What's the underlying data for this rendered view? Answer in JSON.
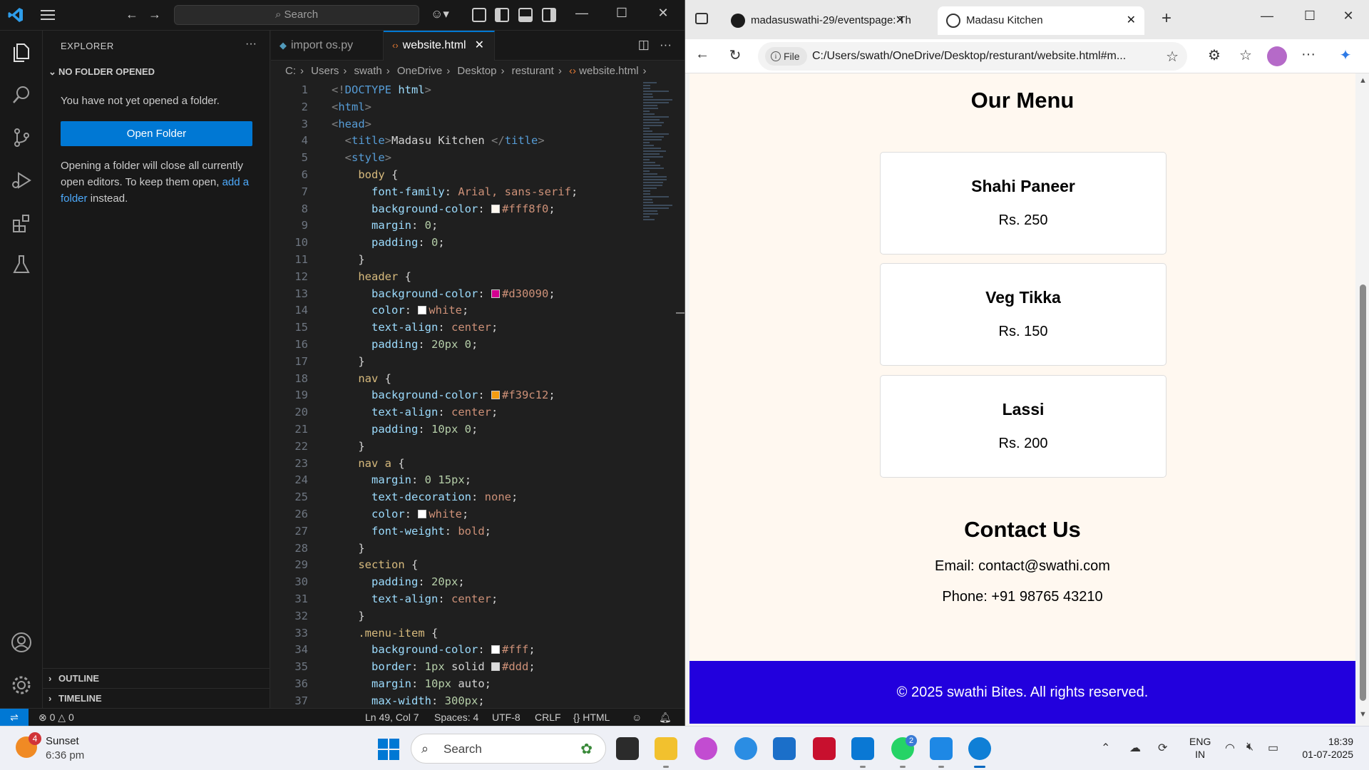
{
  "vscode": {
    "title_search": "Search",
    "sidebar": {
      "title": "EXPLORER",
      "section_open": "NO FOLDER OPENED",
      "message": "You have not yet opened a folder.",
      "open_folder_button": "Open Folder",
      "help_text_1": "Opening a folder will close all currently open editors. To keep them open,",
      "help_link": "add a folder",
      "help_text_2": "instead.",
      "outline": "OUTLINE",
      "timeline": "TIMELINE"
    },
    "tabs": [
      {
        "label": "import os.py",
        "active": false
      },
      {
        "label": "website.html",
        "active": true
      }
    ],
    "breadcrumb": [
      "C:",
      "Users",
      "swath",
      "OneDrive",
      "Desktop",
      "resturant",
      "website.html"
    ],
    "code_lines": [
      "<!DOCTYPE html>",
      "<html>",
      "<head>",
      "  <title>Madasu Kitchen </title>",
      "  <style>",
      "    body {",
      "      font-family: Arial, sans-serif;",
      "      background-color: #fff8f0;",
      "      margin: 0;",
      "      padding: 0;",
      "    }",
      "    header {",
      "      background-color: #d30090;",
      "      color: white;",
      "      text-align: center;",
      "      padding: 20px 0;",
      "    }",
      "    nav {",
      "      background-color: #f39c12;",
      "      text-align: center;",
      "      padding: 10px 0;",
      "    }",
      "    nav a {",
      "      margin: 0 15px;",
      "      text-decoration: none;",
      "      color: white;",
      "      font-weight: bold;",
      "    }",
      "    section {",
      "      padding: 20px;",
      "      text-align: center;",
      "    }",
      "    .menu-item {",
      "      background-color: #fff;",
      "      border: 1px solid #ddd;",
      "      margin: 10px auto;",
      "      max-width: 300px;"
    ],
    "status": {
      "errors": "0",
      "warnings": "0",
      "position": "Ln 49, Col 7",
      "spaces": "Spaces: 4",
      "encoding": "UTF-8",
      "eol": "CRLF",
      "language": "HTML"
    }
  },
  "edge": {
    "tabs": [
      {
        "label": "madasuswathi-29/eventspage: Th",
        "icon": "github-icon",
        "active": false
      },
      {
        "label": "Madasu Kitchen",
        "icon": "globe-icon",
        "active": true
      }
    ],
    "address": {
      "scheme_chip": "File",
      "url": "C:/Users/swath/OneDrive/Desktop/resturant/website.html#m..."
    },
    "page": {
      "menu_heading": "Our Menu",
      "menu_items": [
        {
          "name": "Shahi Paneer",
          "price": "Rs. 250"
        },
        {
          "name": "Veg Tikka",
          "price": "Rs. 150"
        },
        {
          "name": "Lassi",
          "price": "Rs. 200"
        }
      ],
      "contact_heading": "Contact Us",
      "email": "Email: contact@swathi.com",
      "phone": "Phone: +91 98765 43210",
      "footer": "© 2025 swathi Bites. All rights reserved."
    }
  },
  "taskbar": {
    "weather_title": "Sunset",
    "weather_time": "6:36 pm",
    "weather_badge": "4",
    "search_label": "Search",
    "whatsapp_badge": "2",
    "lang_1": "ENG",
    "lang_2": "IN",
    "time": "18:39",
    "date": "01-07-2025"
  },
  "colors": {
    "vscode_accent": "#0078d4",
    "page_background": "#fff8f0",
    "footer_background": "#2200dd"
  }
}
